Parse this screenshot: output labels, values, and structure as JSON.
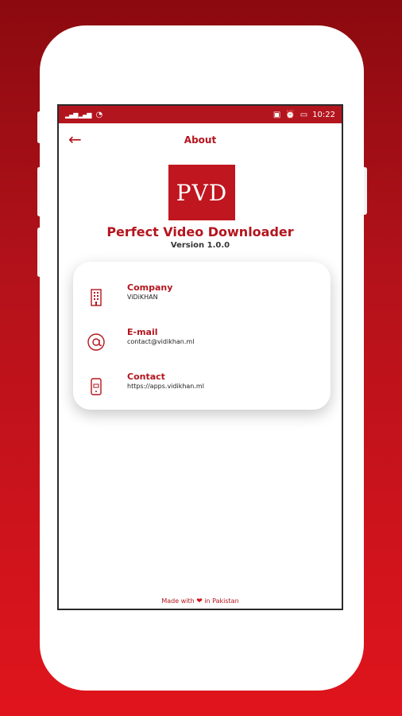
{
  "status_bar": {
    "signal": "∂ˡᴵʱ ∂ˡᴵʱ",
    "time": "10:22"
  },
  "toolbar": {
    "title": "About",
    "back_icon": "arrow-left-icon"
  },
  "app": {
    "logo_text": "PVD",
    "name": "Perfect Video Downloader",
    "version": "Version 1.0.0"
  },
  "info": [
    {
      "icon": "building-icon",
      "title": "Company",
      "value": "ViDiKHAN"
    },
    {
      "icon": "at-icon",
      "title": "E-mail",
      "value": "contact@vidikhan.ml"
    },
    {
      "icon": "phone-icon",
      "title": "Contact",
      "value": "https://apps.vidikhan.ml"
    }
  ],
  "footer": {
    "before": "Made with",
    "after": "in Pakistan"
  },
  "colors": {
    "accent": "#b3151e",
    "background_gradient_top": "#8b0a0f",
    "background_gradient_bottom": "#e0141c"
  }
}
